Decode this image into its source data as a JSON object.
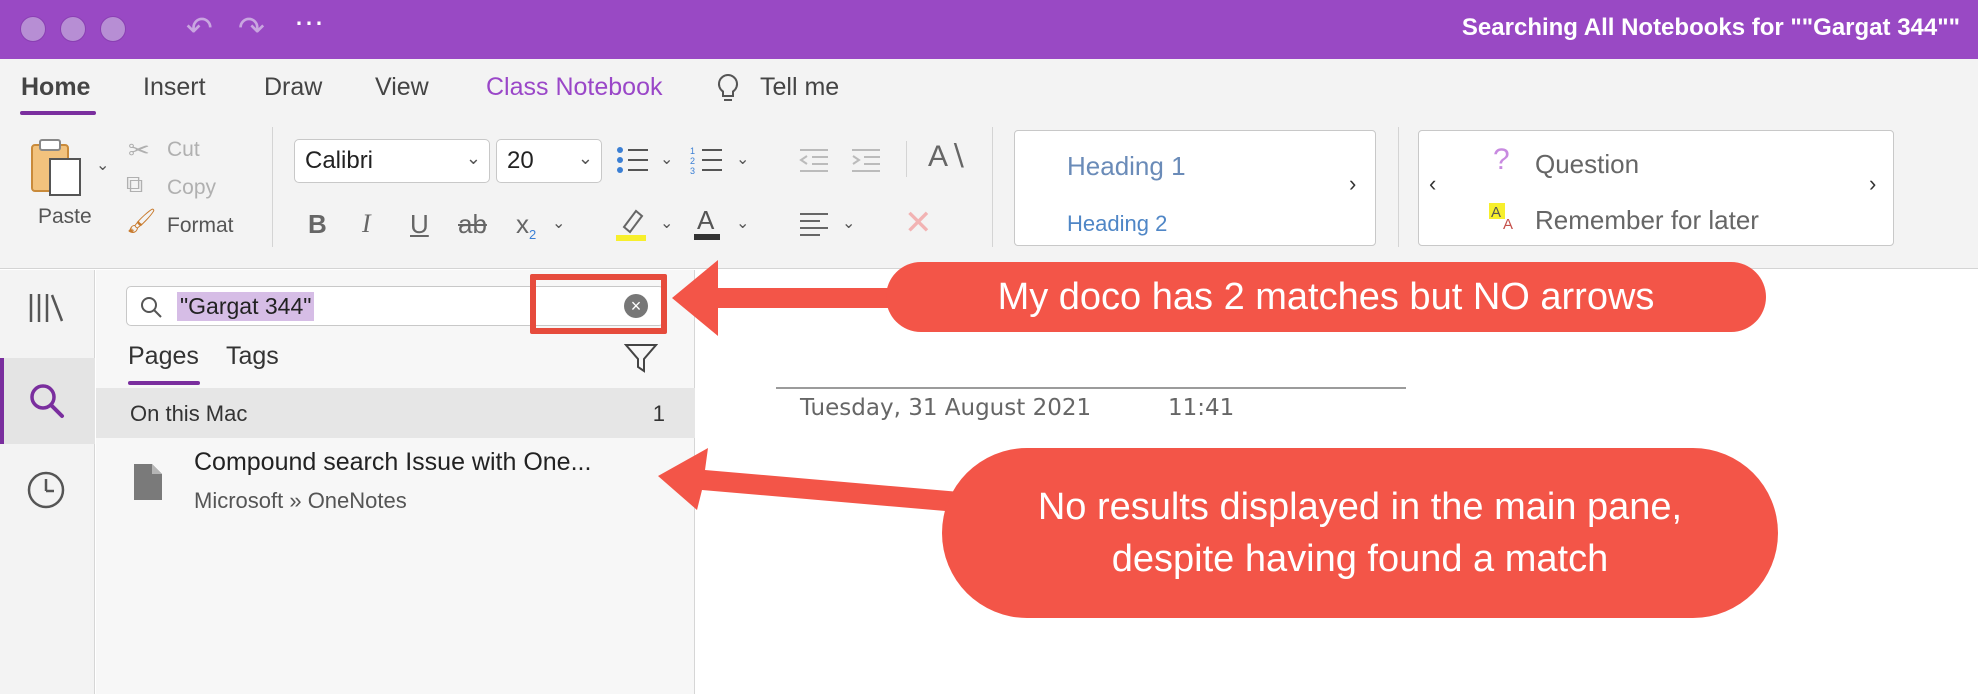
{
  "window": {
    "title": "Searching All Notebooks for \"\"Gargat 344\"\""
  },
  "tabs": [
    {
      "label": "Home",
      "active": true
    },
    {
      "label": "Insert"
    },
    {
      "label": "Draw"
    },
    {
      "label": "View"
    },
    {
      "label": "Class Notebook"
    },
    {
      "label": "Tell me"
    }
  ],
  "ribbon": {
    "paste_label": "Paste",
    "cut_label": "Cut",
    "copy_label": "Copy",
    "format_label": "Format",
    "font_name": "Calibri",
    "font_size": "20",
    "styles": {
      "heading1": "Heading 1",
      "heading2": "Heading 2"
    },
    "tags": {
      "question": "Question",
      "remember": "Remember for later"
    }
  },
  "search": {
    "query": "\"Gargat 344\"",
    "tabs": [
      "Pages",
      "Tags"
    ],
    "group_label": "On this Mac",
    "group_count": "1",
    "results": [
      {
        "title": "Compound search Issue with One...",
        "path": "Microsoft » OneNotes"
      }
    ]
  },
  "page": {
    "date": "Tuesday, 31 August 2021",
    "time": "11:41"
  },
  "annotations": {
    "callout1": "My doco has 2 matches but NO arrows",
    "callout2_line1": "No results displayed in the main pane,",
    "callout2_line2": "despite having found a match"
  },
  "colors": {
    "titlebar": "#9949c4",
    "accent": "#7a2e9e",
    "callout": "#f35548",
    "highlight_box": "#e64b3c"
  }
}
